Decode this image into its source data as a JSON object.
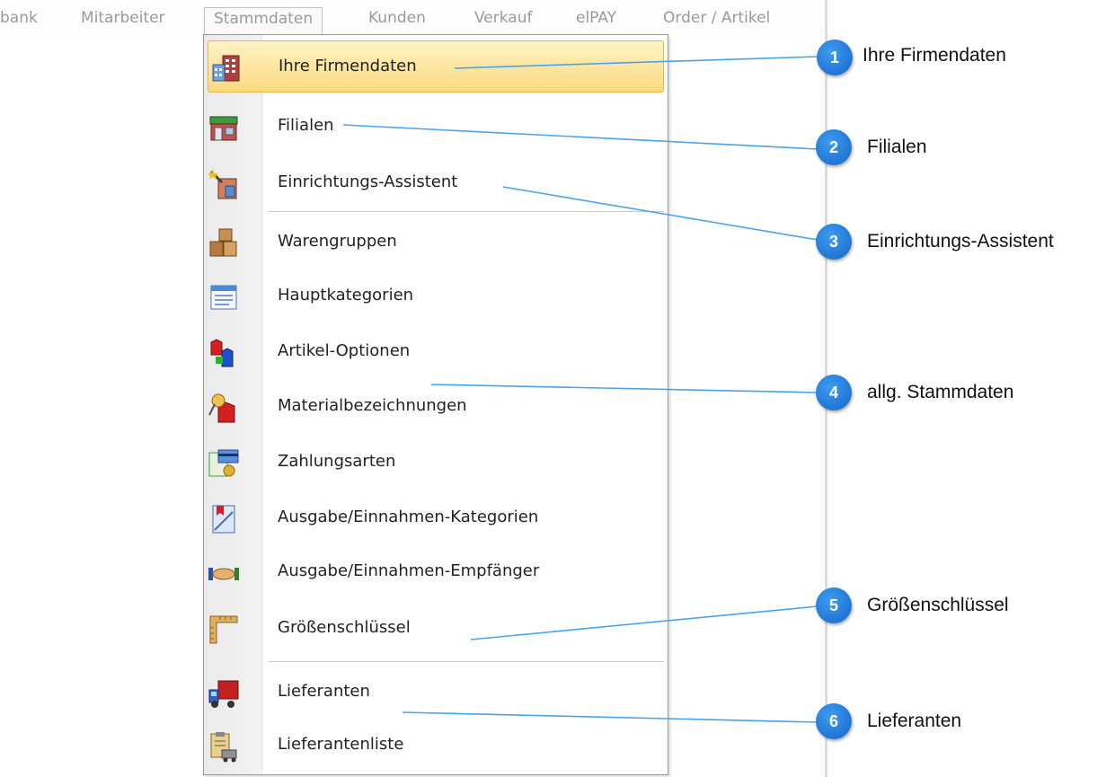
{
  "menubar": {
    "items": [
      "bank",
      "Mitarbeiter",
      "Stammdaten",
      "Kunden",
      "Verkauf",
      "elPAY",
      "Order / Artikel"
    ]
  },
  "menu": {
    "items": [
      {
        "label": "Ihre Firmendaten",
        "icon": "building-icon",
        "highlighted": true
      },
      {
        "label": "Filialen",
        "icon": "storefront-icon"
      },
      {
        "label": "Einrichtungs-Assistent",
        "icon": "wizard-icon"
      },
      {
        "label": "Warengruppen",
        "icon": "boxes-icon"
      },
      {
        "label": "Hauptkategorien",
        "icon": "window-list-icon"
      },
      {
        "label": "Artikel-Optionen",
        "icon": "shirts-icon"
      },
      {
        "label": "Materialbezeichnungen",
        "icon": "pin-shirt-icon"
      },
      {
        "label": "Zahlungsarten",
        "icon": "payment-icon"
      },
      {
        "label": "Ausgabe/Einnahmen-Kategorien",
        "icon": "bookmark-icon"
      },
      {
        "label": "Ausgabe/Einnahmen-Empfänger",
        "icon": "handshake-icon"
      },
      {
        "label": "Größenschlüssel",
        "icon": "ruler-icon"
      },
      {
        "label": "Lieferanten",
        "icon": "truck-icon"
      },
      {
        "label": "Lieferantenliste",
        "icon": "clipboard-truck-icon"
      }
    ]
  },
  "callouts": [
    {
      "num": "1",
      "text": "Ihre Firmendaten"
    },
    {
      "num": "2",
      "text": "Filialen"
    },
    {
      "num": "3",
      "text": "Einrichtungs-Assistent"
    },
    {
      "num": "4",
      "text": "allg. Stammdaten"
    },
    {
      "num": "5",
      "text": "Größenschlüssel"
    },
    {
      "num": "6",
      "text": "Lieferanten"
    }
  ],
  "colors": {
    "callout": "#1f78d8",
    "leader_line": "#4aa3ee",
    "highlight": "#fbd980"
  }
}
